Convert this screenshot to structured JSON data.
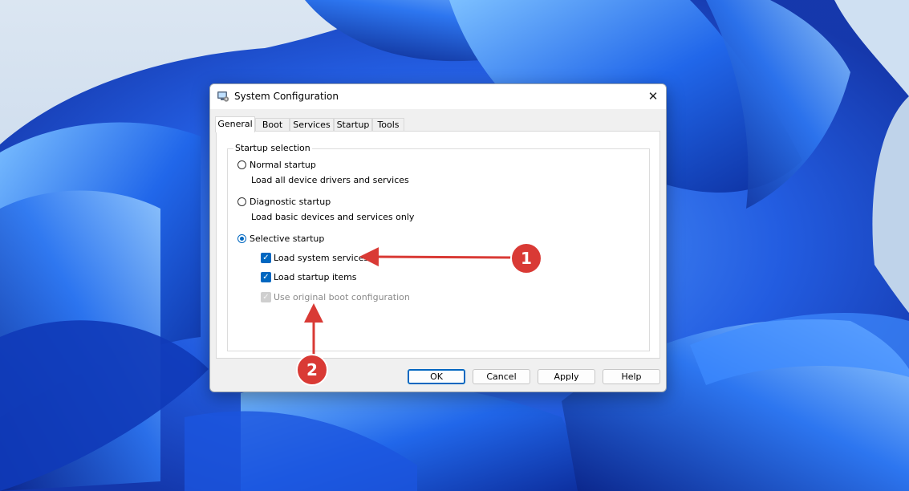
{
  "window": {
    "title": "System Configuration",
    "close_glyph": "✕"
  },
  "tabs": [
    {
      "label": "General",
      "active": true
    },
    {
      "label": "Boot",
      "active": false
    },
    {
      "label": "Services",
      "active": false
    },
    {
      "label": "Startup",
      "active": false
    },
    {
      "label": "Tools",
      "active": false
    }
  ],
  "startup_selection": {
    "group_label": "Startup selection",
    "normal": {
      "label": "Normal startup",
      "description": "Load all device drivers and services",
      "selected": false
    },
    "diagnostic": {
      "label": "Diagnostic startup",
      "description": "Load basic devices and services only",
      "selected": false
    },
    "selective": {
      "label": "Selective startup",
      "selected": true,
      "options": {
        "load_system_services": {
          "label": "Load system services",
          "checked": true,
          "enabled": true
        },
        "load_startup_items": {
          "label": "Load startup items",
          "checked": true,
          "enabled": true
        },
        "use_original_boot_config": {
          "label": "Use original boot configuration",
          "checked": true,
          "enabled": false
        }
      }
    }
  },
  "buttons": {
    "ok": "OK",
    "cancel": "Cancel",
    "apply": "Apply",
    "help": "Help"
  },
  "callouts": {
    "one": "1",
    "two": "2"
  },
  "icons": {
    "app": "system-configuration-icon",
    "close": "close-icon",
    "check": "checkmark-icon"
  },
  "colors": {
    "accent": "#0067c0",
    "callout": "#d93a35",
    "dialog_bg": "#f0f0f0",
    "wallpaper_base": "#c9d8ea",
    "wallpaper_bloom": "#1f5fe0"
  }
}
